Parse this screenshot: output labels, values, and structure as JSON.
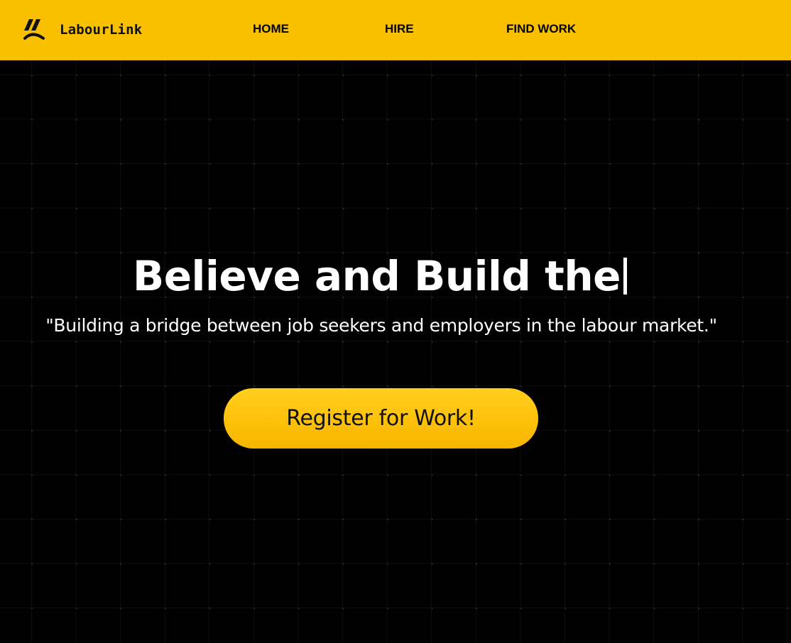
{
  "header": {
    "brand": {
      "name": "LabourLink",
      "icon": "labourlink-logo-icon"
    },
    "nav": [
      {
        "label": "HOME"
      },
      {
        "label": "HIRE"
      },
      {
        "label": "FIND WORK"
      }
    ]
  },
  "hero": {
    "headline": "Believe and Build the",
    "tagline": "\"Building a bridge between job seekers and employers in the labour market.\"",
    "cta_label": "Register for Work!"
  },
  "colors": {
    "accent": "#f9c000",
    "background": "#000000",
    "text": "#ffffff",
    "grid_line": "#1c1c1c"
  }
}
